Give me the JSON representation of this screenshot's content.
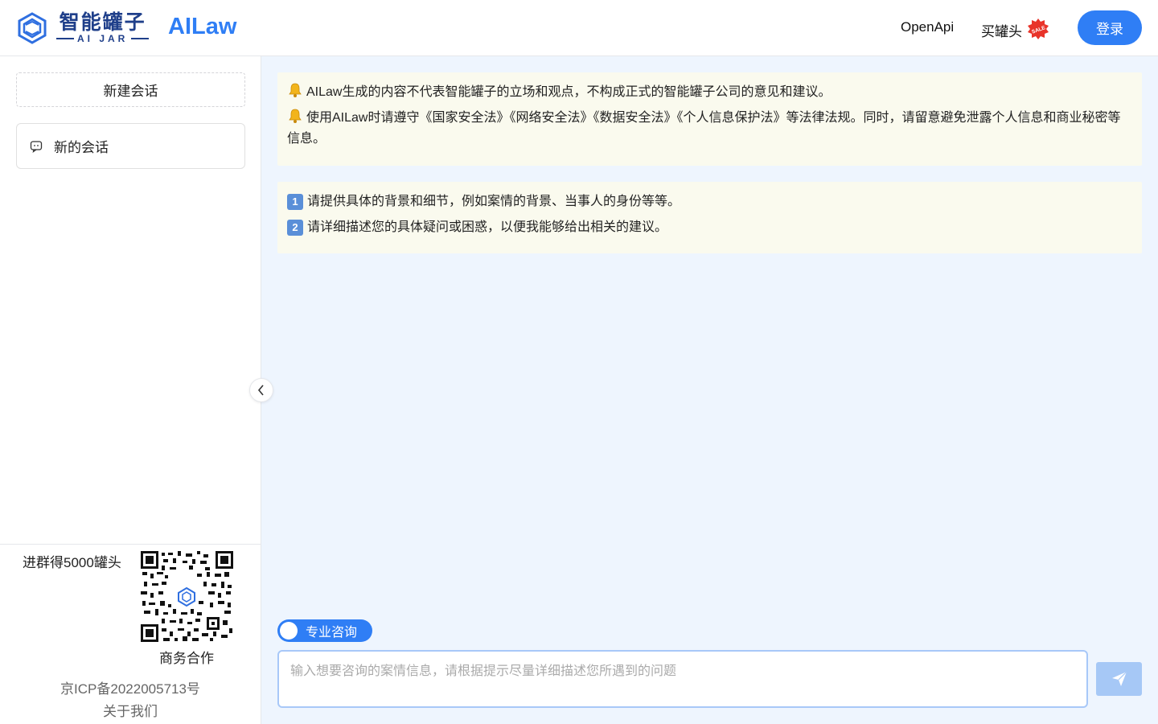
{
  "header": {
    "logo_cn": "智能罐子",
    "logo_en": "AI JAR",
    "app_name": "AILaw",
    "nav_openapi": "OpenApi",
    "nav_buy": "买罐头",
    "sale_badge_text": "SALE",
    "login_label": "登录"
  },
  "sidebar": {
    "new_chat_label": "新建会话",
    "chats": [
      {
        "label": "新的会话",
        "icon": "chat-bubble-icon"
      }
    ],
    "promo_text": "进群得5000罐头",
    "biz_text": "商务合作",
    "icp_text": "京ICP备2022005713号",
    "about_text": "关于我们"
  },
  "main": {
    "notices": [
      {
        "icon": "bell-icon",
        "text": "AILaw生成的内容不代表智能罐子的立场和观点，不构成正式的智能罐子公司的意见和建议。"
      },
      {
        "icon": "bell-icon",
        "text": "使用AILaw时请遵守《国家安全法》《网络安全法》《数据安全法》《个人信息保护法》等法律法规。同时，请留意避免泄露个人信息和商业秘密等信息。"
      }
    ],
    "tips": [
      {
        "num": "1",
        "text": "请提供具体的背景和细节，例如案情的背景、当事人的身份等等。"
      },
      {
        "num": "2",
        "text": "请详细描述您的具体疑问或困惑，以便我能够给出相关的建议。"
      }
    ],
    "toggle_label": "专业咨询",
    "toggle_on": true,
    "input_placeholder": "输入想要咨询的案情信息，请根据提示尽量详细描述您所遇到的问题",
    "input_value": ""
  },
  "colors": {
    "accent": "#2f7ef5",
    "brand_dark": "#1f3f8a",
    "notice_bg": "#fafaee",
    "main_bg": "#eef5fe",
    "send_disabled": "#a6c8f6"
  }
}
